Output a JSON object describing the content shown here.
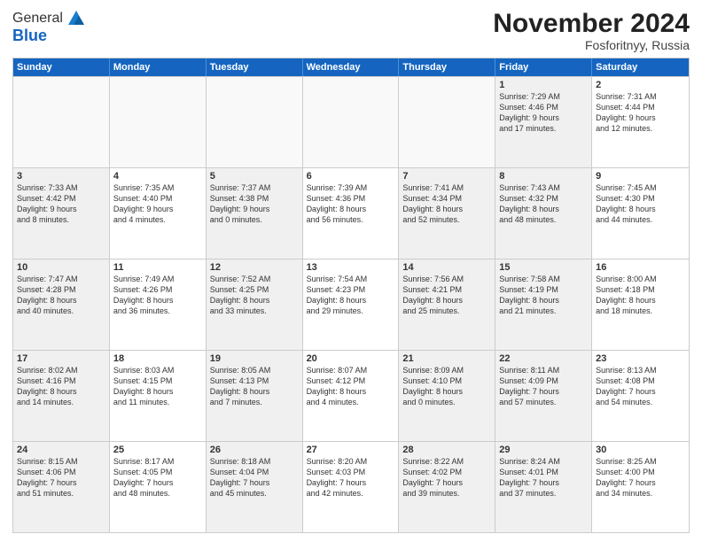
{
  "logo": {
    "line1": "General",
    "line2": "Blue"
  },
  "title": "November 2024",
  "location": "Fosforitnyy, Russia",
  "header_days": [
    "Sunday",
    "Monday",
    "Tuesday",
    "Wednesday",
    "Thursday",
    "Friday",
    "Saturday"
  ],
  "weeks": [
    [
      {
        "day": "",
        "info": "",
        "empty": true
      },
      {
        "day": "",
        "info": "",
        "empty": true
      },
      {
        "day": "",
        "info": "",
        "empty": true
      },
      {
        "day": "",
        "info": "",
        "empty": true
      },
      {
        "day": "",
        "info": "",
        "empty": true
      },
      {
        "day": "1",
        "info": "Sunrise: 7:29 AM\nSunset: 4:46 PM\nDaylight: 9 hours\nand 17 minutes.",
        "shaded": true
      },
      {
        "day": "2",
        "info": "Sunrise: 7:31 AM\nSunset: 4:44 PM\nDaylight: 9 hours\nand 12 minutes.",
        "shaded": false
      }
    ],
    [
      {
        "day": "3",
        "info": "Sunrise: 7:33 AM\nSunset: 4:42 PM\nDaylight: 9 hours\nand 8 minutes.",
        "shaded": true
      },
      {
        "day": "4",
        "info": "Sunrise: 7:35 AM\nSunset: 4:40 PM\nDaylight: 9 hours\nand 4 minutes.",
        "shaded": false
      },
      {
        "day": "5",
        "info": "Sunrise: 7:37 AM\nSunset: 4:38 PM\nDaylight: 9 hours\nand 0 minutes.",
        "shaded": true
      },
      {
        "day": "6",
        "info": "Sunrise: 7:39 AM\nSunset: 4:36 PM\nDaylight: 8 hours\nand 56 minutes.",
        "shaded": false
      },
      {
        "day": "7",
        "info": "Sunrise: 7:41 AM\nSunset: 4:34 PM\nDaylight: 8 hours\nand 52 minutes.",
        "shaded": true
      },
      {
        "day": "8",
        "info": "Sunrise: 7:43 AM\nSunset: 4:32 PM\nDaylight: 8 hours\nand 48 minutes.",
        "shaded": true
      },
      {
        "day": "9",
        "info": "Sunrise: 7:45 AM\nSunset: 4:30 PM\nDaylight: 8 hours\nand 44 minutes.",
        "shaded": false
      }
    ],
    [
      {
        "day": "10",
        "info": "Sunrise: 7:47 AM\nSunset: 4:28 PM\nDaylight: 8 hours\nand 40 minutes.",
        "shaded": true
      },
      {
        "day": "11",
        "info": "Sunrise: 7:49 AM\nSunset: 4:26 PM\nDaylight: 8 hours\nand 36 minutes.",
        "shaded": false
      },
      {
        "day": "12",
        "info": "Sunrise: 7:52 AM\nSunset: 4:25 PM\nDaylight: 8 hours\nand 33 minutes.",
        "shaded": true
      },
      {
        "day": "13",
        "info": "Sunrise: 7:54 AM\nSunset: 4:23 PM\nDaylight: 8 hours\nand 29 minutes.",
        "shaded": false
      },
      {
        "day": "14",
        "info": "Sunrise: 7:56 AM\nSunset: 4:21 PM\nDaylight: 8 hours\nand 25 minutes.",
        "shaded": true
      },
      {
        "day": "15",
        "info": "Sunrise: 7:58 AM\nSunset: 4:19 PM\nDaylight: 8 hours\nand 21 minutes.",
        "shaded": true
      },
      {
        "day": "16",
        "info": "Sunrise: 8:00 AM\nSunset: 4:18 PM\nDaylight: 8 hours\nand 18 minutes.",
        "shaded": false
      }
    ],
    [
      {
        "day": "17",
        "info": "Sunrise: 8:02 AM\nSunset: 4:16 PM\nDaylight: 8 hours\nand 14 minutes.",
        "shaded": true
      },
      {
        "day": "18",
        "info": "Sunrise: 8:03 AM\nSunset: 4:15 PM\nDaylight: 8 hours\nand 11 minutes.",
        "shaded": false
      },
      {
        "day": "19",
        "info": "Sunrise: 8:05 AM\nSunset: 4:13 PM\nDaylight: 8 hours\nand 7 minutes.",
        "shaded": true
      },
      {
        "day": "20",
        "info": "Sunrise: 8:07 AM\nSunset: 4:12 PM\nDaylight: 8 hours\nand 4 minutes.",
        "shaded": false
      },
      {
        "day": "21",
        "info": "Sunrise: 8:09 AM\nSunset: 4:10 PM\nDaylight: 8 hours\nand 0 minutes.",
        "shaded": true
      },
      {
        "day": "22",
        "info": "Sunrise: 8:11 AM\nSunset: 4:09 PM\nDaylight: 7 hours\nand 57 minutes.",
        "shaded": true
      },
      {
        "day": "23",
        "info": "Sunrise: 8:13 AM\nSunset: 4:08 PM\nDaylight: 7 hours\nand 54 minutes.",
        "shaded": false
      }
    ],
    [
      {
        "day": "24",
        "info": "Sunrise: 8:15 AM\nSunset: 4:06 PM\nDaylight: 7 hours\nand 51 minutes.",
        "shaded": true
      },
      {
        "day": "25",
        "info": "Sunrise: 8:17 AM\nSunset: 4:05 PM\nDaylight: 7 hours\nand 48 minutes.",
        "shaded": false
      },
      {
        "day": "26",
        "info": "Sunrise: 8:18 AM\nSunset: 4:04 PM\nDaylight: 7 hours\nand 45 minutes.",
        "shaded": true
      },
      {
        "day": "27",
        "info": "Sunrise: 8:20 AM\nSunset: 4:03 PM\nDaylight: 7 hours\nand 42 minutes.",
        "shaded": false
      },
      {
        "day": "28",
        "info": "Sunrise: 8:22 AM\nSunset: 4:02 PM\nDaylight: 7 hours\nand 39 minutes.",
        "shaded": true
      },
      {
        "day": "29",
        "info": "Sunrise: 8:24 AM\nSunset: 4:01 PM\nDaylight: 7 hours\nand 37 minutes.",
        "shaded": true
      },
      {
        "day": "30",
        "info": "Sunrise: 8:25 AM\nSunset: 4:00 PM\nDaylight: 7 hours\nand 34 minutes.",
        "shaded": false
      }
    ]
  ]
}
